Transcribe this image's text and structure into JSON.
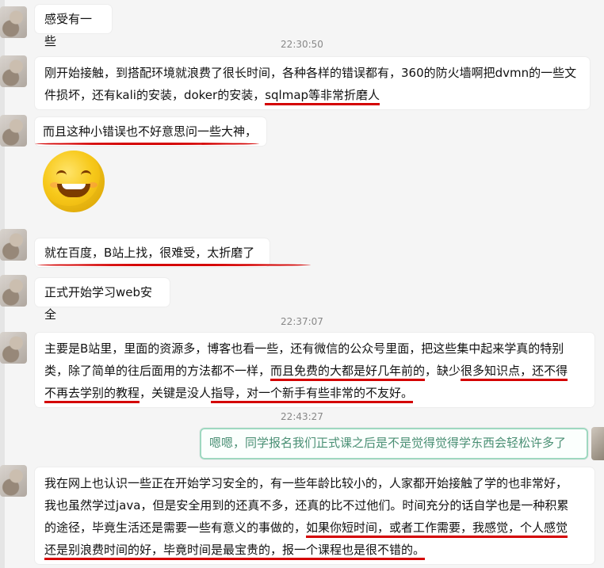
{
  "messages": {
    "m1": "感受有一些",
    "t1": "22:30:50",
    "m2_part1": "刚开始接触，到搭配环境就浪费了很长时间，各种各样的错误都有，360的防火墙啊把dvmn的一些文件损坏，还有kali的安装，doker的安装，",
    "m2_part2": "sqlmap等非常折磨人",
    "m3_part1": "而且这种小错误也不好意思问一些大神，",
    "m4": "就在百度，B站上找，很难受，太折磨了",
    "m5": "正式开始学习web安全",
    "t2": "22:37:07",
    "m6_line1": "主要是B站里，里面的资源多，博客也看一些，还有微信的公众号里面，把这些集中起来学真的特别",
    "m6_line2a": "类，除了简单的往后面用的方法都不一样，",
    "m6_line2b": "而且免费的大都是好几年前的",
    "m6_line2c": "，缺少",
    "m6_line2d": "很多知识点",
    "m6_line2e": "，还不得",
    "m6_line3a": "不再去学别的教程",
    "m6_line3b": "，关键是没人",
    "m6_line3c": "指导",
    "m6_line3d": "，对一个新手有些非常的不友好。",
    "t3": "22:43:27",
    "m7": "嗯嗯，同学报名我们正式课之后是不是觉得觉得学东西会轻松许多了",
    "m8_line1": "我在网上也认识一些正在开始学习安全的，有一些年龄比较小的，人家都开始接触了学的也非常好，",
    "m8_line2": "我也虽然学过java，但是安全用到的还真不多，还真的比不过他们。时间充分的话自学也是一种积累",
    "m8_line3a": "的途径，毕竟生活还是需要一些有意义的事做的，",
    "m8_line3b": "如果你短时间，或者工作需要，我感觉，个人感觉",
    "m8_line4a": "还是别浪费时间的好，毕竟时间是最宝贵的，",
    "m8_line4b": "报一个课程也是很不错的。"
  }
}
